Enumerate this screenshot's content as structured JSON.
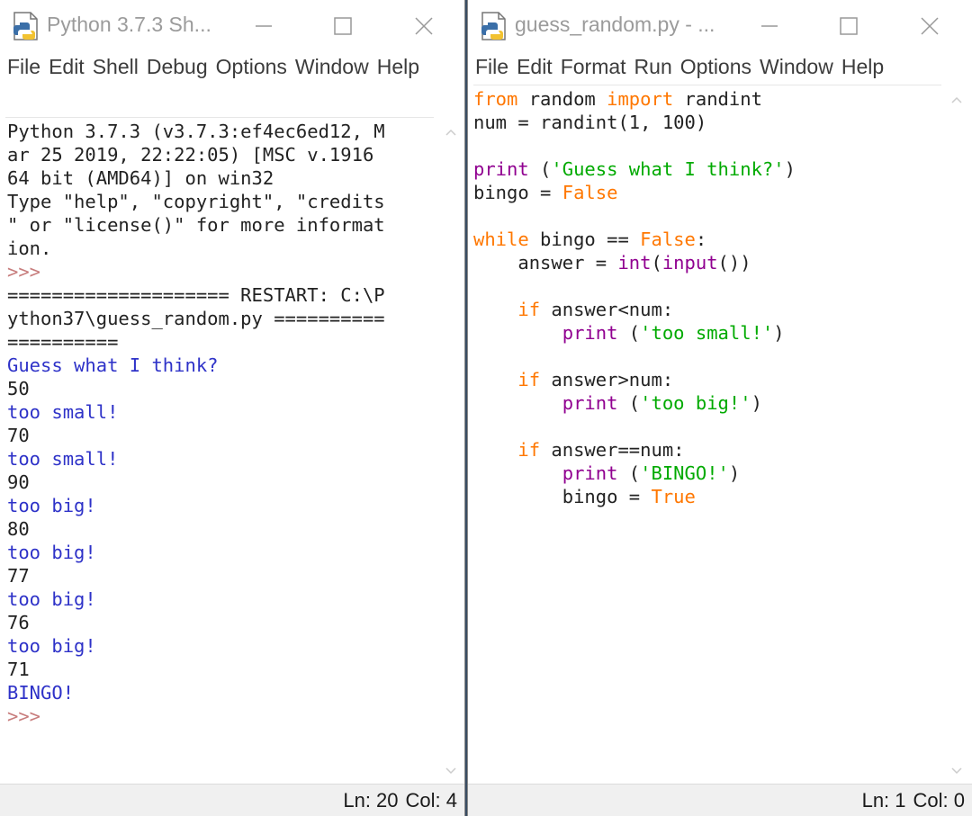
{
  "shell": {
    "title": "Python 3.7.3 Sh...",
    "menus": [
      "File",
      "Edit",
      "Shell",
      "Debug",
      "Options",
      "Window",
      "Help"
    ],
    "status": {
      "line": "Ln: 20",
      "col": "Col: 4"
    },
    "lines": [
      {
        "text": "Python 3.7.3 (v3.7.3:ef4ec6ed12, M",
        "type": "normal"
      },
      {
        "text": "ar 25 2019, 22:22:05) [MSC v.1916",
        "type": "normal"
      },
      {
        "text": "64 bit (AMD64)] on win32",
        "type": "normal"
      },
      {
        "text": "Type \"help\", \"copyright\", \"credits",
        "type": "normal"
      },
      {
        "text": "\" or \"license()\" for more informat",
        "type": "normal"
      },
      {
        "text": "ion.",
        "type": "normal"
      },
      {
        "text": ">>> ",
        "type": "prompt"
      },
      {
        "text": "==================== RESTART: C:\\P",
        "type": "normal"
      },
      {
        "text": "ython37\\guess_random.py ==========",
        "type": "normal"
      },
      {
        "text": "==========",
        "type": "normal"
      },
      {
        "text": "Guess what I think?",
        "type": "stdout"
      },
      {
        "text": "50",
        "type": "normal"
      },
      {
        "text": "too small!",
        "type": "stdout"
      },
      {
        "text": "70",
        "type": "normal"
      },
      {
        "text": "too small!",
        "type": "stdout"
      },
      {
        "text": "90",
        "type": "normal"
      },
      {
        "text": "too big!",
        "type": "stdout"
      },
      {
        "text": "80",
        "type": "normal"
      },
      {
        "text": "too big!",
        "type": "stdout"
      },
      {
        "text": "77",
        "type": "normal"
      },
      {
        "text": "too big!",
        "type": "stdout"
      },
      {
        "text": "76",
        "type": "normal"
      },
      {
        "text": "too big!",
        "type": "stdout"
      },
      {
        "text": "71",
        "type": "normal"
      },
      {
        "text": "BINGO!",
        "type": "stdout"
      },
      {
        "text": ">>> ",
        "type": "prompt"
      }
    ]
  },
  "editor": {
    "title": "guess_random.py - ...",
    "menus": [
      "File",
      "Edit",
      "Format",
      "Run",
      "Options",
      "Window",
      "Help"
    ],
    "status": {
      "line": "Ln: 1",
      "col": "Col: 0"
    },
    "lines": [
      [
        [
          "kw",
          "from"
        ],
        [
          "n",
          " random "
        ],
        [
          "kw",
          "import"
        ],
        [
          "n",
          " randint"
        ]
      ],
      [
        [
          "n",
          "num = randint(1, 100)"
        ]
      ],
      [],
      [
        [
          "bi",
          "print"
        ],
        [
          "n",
          " ("
        ],
        [
          "str",
          "'Guess what I think?'"
        ],
        [
          "n",
          ")"
        ]
      ],
      [
        [
          "n",
          "bingo = "
        ],
        [
          "kw",
          "False"
        ]
      ],
      [],
      [
        [
          "kw",
          "while"
        ],
        [
          "n",
          " bingo == "
        ],
        [
          "kw",
          "False"
        ],
        [
          "n",
          ":"
        ]
      ],
      [
        [
          "n",
          "    answer = "
        ],
        [
          "bi",
          "int"
        ],
        [
          "n",
          "("
        ],
        [
          "bi",
          "input"
        ],
        [
          "n",
          "())"
        ]
      ],
      [],
      [
        [
          "n",
          "    "
        ],
        [
          "kw",
          "if"
        ],
        [
          "n",
          " answer<num:"
        ]
      ],
      [
        [
          "n",
          "        "
        ],
        [
          "bi",
          "print"
        ],
        [
          "n",
          " ("
        ],
        [
          "str",
          "'too small!'"
        ],
        [
          "n",
          ")"
        ]
      ],
      [],
      [
        [
          "n",
          "    "
        ],
        [
          "kw",
          "if"
        ],
        [
          "n",
          " answer>num:"
        ]
      ],
      [
        [
          "n",
          "        "
        ],
        [
          "bi",
          "print"
        ],
        [
          "n",
          " ("
        ],
        [
          "str",
          "'too big!'"
        ],
        [
          "n",
          ")"
        ]
      ],
      [],
      [
        [
          "n",
          "    "
        ],
        [
          "kw",
          "if"
        ],
        [
          "n",
          " answer==num:"
        ]
      ],
      [
        [
          "n",
          "        "
        ],
        [
          "bi",
          "print"
        ],
        [
          "n",
          " ("
        ],
        [
          "str",
          "'BINGO!'"
        ],
        [
          "n",
          ")"
        ]
      ],
      [
        [
          "n",
          "        bingo = "
        ],
        [
          "kw",
          "True"
        ]
      ]
    ]
  },
  "colors": {
    "keyword": "#ff7700",
    "builtin": "#900090",
    "string": "#00aa00",
    "stdout": "#2e32c8",
    "prompt": "#c77c7c"
  },
  "icons": [
    "python-idle-icon",
    "minimize-icon",
    "maximize-icon",
    "close-icon"
  ]
}
